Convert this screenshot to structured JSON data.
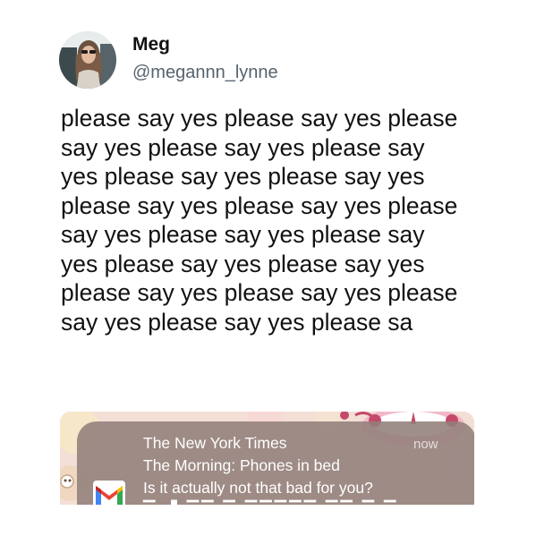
{
  "tweet": {
    "author": {
      "name": "Meg",
      "handle": "@megannn_lynne"
    },
    "text_lines": [
      "please say yes please say yes please",
      "say yes please say yes please say",
      "yes please say yes please say yes",
      "please say yes please say yes please",
      "say yes please say yes please say",
      "yes please say yes please say yes",
      "please say yes please say yes please",
      "say yes please say yes please sa"
    ]
  },
  "notification": {
    "app_icon": "gmail-icon",
    "source": "The New York Times",
    "time": "now",
    "title": "The Morning: Phones in bed",
    "body": "Is it actually not that bad for you?"
  },
  "colors": {
    "text": "#111111",
    "handle": "#56636e",
    "banner": "#92807a",
    "gmail_red": "#ea4335",
    "gmail_blue": "#4285f4",
    "gmail_green": "#34a853",
    "gmail_yellow": "#fbbc04"
  }
}
